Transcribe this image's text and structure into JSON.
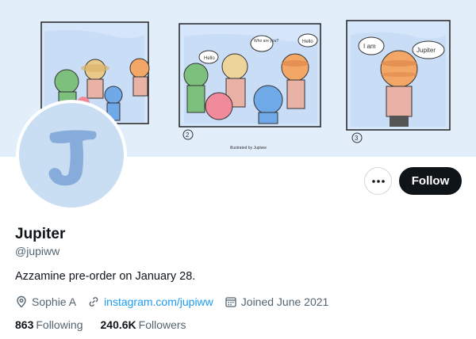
{
  "profile": {
    "display_name": "Jupiter",
    "handle": "@jupiww",
    "bio": "Azzamine pre-order on January 28.",
    "location": "Sophie A",
    "website": "instagram.com/jupiww",
    "joined": "Joined June 2021",
    "following_count": "863",
    "following_label": "Following",
    "followers_count": "240.6K",
    "followers_label": "Followers"
  },
  "actions": {
    "follow_label": "Follow",
    "more_icon": "more-horizontal-icon"
  },
  "banner": {
    "speech_bubbles": [
      "Hello",
      "Who are you?",
      "Hello",
      "I am",
      "Jupiter"
    ],
    "panel_numbers": [
      "2",
      "3"
    ],
    "caption": "illustrated by Jupiww"
  },
  "avatar": {
    "letter": "J"
  },
  "icons": {
    "location": "location-pin-icon",
    "website": "link-icon",
    "joined": "calendar-icon"
  },
  "colors": {
    "accent": "#1d9bf0",
    "text_primary": "#0f1419",
    "text_secondary": "#536471",
    "follow_bg": "#0f1419",
    "banner_bg": "#e3eefb"
  }
}
